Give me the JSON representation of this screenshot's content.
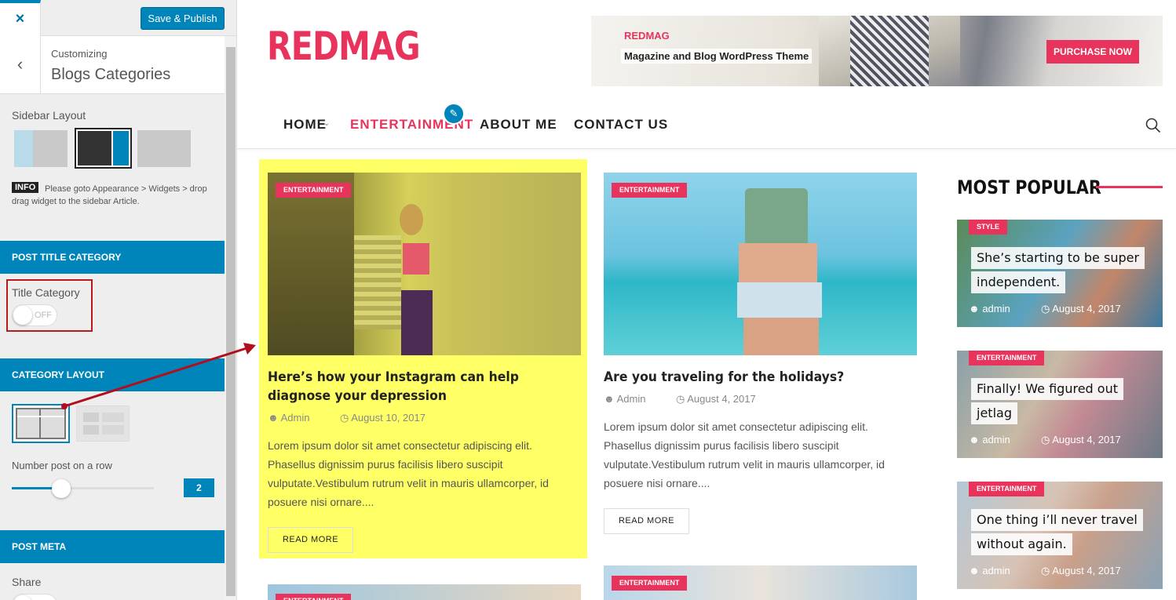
{
  "customizer": {
    "close_icon": "×",
    "save_label": "Save & Publish",
    "back_icon": "‹",
    "crumb": "Customizing",
    "title": "Blogs Categories",
    "sidebar_layout_label": "Sidebar Layout",
    "info_tag": "INFO",
    "info_text": "Please goto Appearance > Widgets > drop drag widget to the sidebar Article.",
    "section_post_title_category": "POST TITLE CATEGORY",
    "title_category_label": "Title Category",
    "title_category_toggle": "OFF",
    "section_category_layout": "CATEGORY LAYOUT",
    "number_post_label": "Number post on a row",
    "number_post_value": "2",
    "section_post_meta": "POST META",
    "share_label": "Share",
    "accent": "#0085ba"
  },
  "site": {
    "logo": "REDMAG",
    "banner": {
      "brand": "REDMAG",
      "tagline": "Magazine and Blog WordPress Theme",
      "button": "PURCHASE NOW"
    },
    "nav": [
      "HOME",
      "ENTERTAINMENT",
      "ABOUT ME",
      "CONTACT US"
    ],
    "accent": "#e8345d",
    "posts": [
      {
        "badge": "ENTERTAINMENT",
        "title": "Here’s how your Instagram can help diagnose your depression",
        "author": "Admin",
        "date": "August 10, 2017",
        "excerpt": "Lorem ipsum dolor sit amet consectetur adipiscing elit. Phasellus dignissim purus facilisis libero suscipit vulputate.Vestibulum rutrum velit in mauris ullamcorper, id posuere nisi ornare....",
        "read_more": "READ MORE"
      },
      {
        "badge": "ENTERTAINMENT",
        "title": "Are you traveling for the holidays?",
        "author": "Admin",
        "date": "August 4, 2017",
        "excerpt": "Lorem ipsum dolor sit amet consectetur adipiscing elit. Phasellus dignissim purus facilisis libero suscipit vulputate.Vestibulum rutrum velit in mauris ullamcorper, id posuere nisi ornare....",
        "read_more": "READ MORE"
      },
      {
        "badge": "ENTERTAINMENT"
      },
      {
        "badge": "ENTERTAINMENT"
      }
    ],
    "most_popular": {
      "title": "MOST POPULAR",
      "items": [
        {
          "badge": "STYLE",
          "line1": "She’s starting to be super",
          "line2": "independent.",
          "author": "admin",
          "date": "August 4, 2017"
        },
        {
          "badge": "ENTERTAINMENT",
          "line1": "Finally! We figured out",
          "line2": "jetlag",
          "author": "admin",
          "date": "August 4, 2017"
        },
        {
          "badge": "ENTERTAINMENT",
          "line1": "One thing i’ll never travel",
          "line2": "without again.",
          "author": "admin",
          "date": "August 4, 2017"
        }
      ]
    }
  }
}
